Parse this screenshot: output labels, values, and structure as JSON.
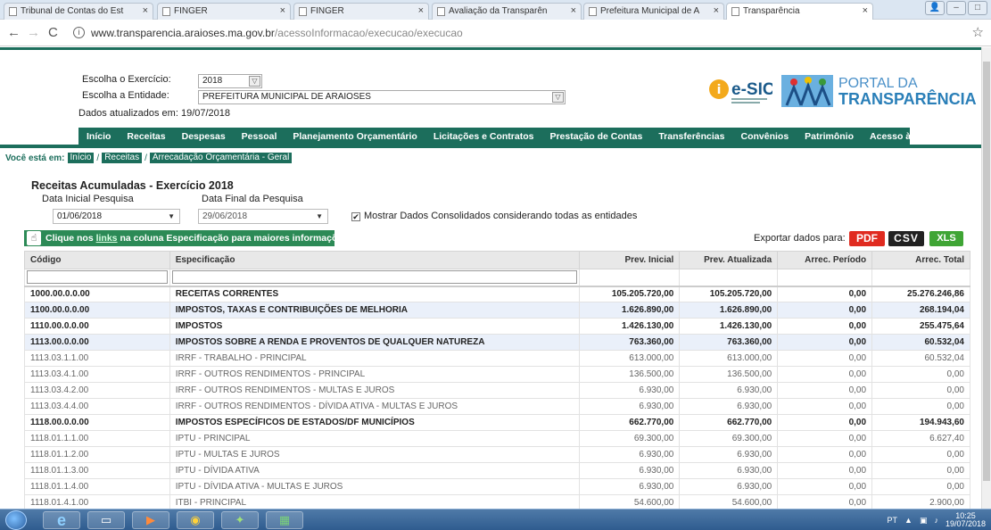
{
  "browser": {
    "tabs": [
      {
        "title": "Tribunal de Contas do Est",
        "active": false
      },
      {
        "title": "FINGER",
        "active": false
      },
      {
        "title": "FINGER",
        "active": false
      },
      {
        "title": "Avaliação da Transparên",
        "active": false
      },
      {
        "title": "Prefeitura Municipal de A",
        "active": false
      },
      {
        "title": "Transparência",
        "active": true
      }
    ],
    "url_host": "www.transparencia.araioses.ma.gov.br",
    "url_path": "/acessoInformacao/execucao/execucao"
  },
  "filters": {
    "exercicio_label": "Escolha o Exercício:",
    "exercicio_value": "2018",
    "entidade_label": "Escolha a Entidade:",
    "entidade_value": "PREFEITURA MUNICIPAL DE ARAIOSES",
    "updated": "Dados atualizados em: 19/07/2018"
  },
  "logos": {
    "esic": "e-SIC",
    "portal_line1": "PORTAL DA",
    "portal_line2": "TRANSPARÊNCIA"
  },
  "nav": [
    "Início",
    "Receitas",
    "Despesas",
    "Pessoal",
    "Planejamento Orçamentário",
    "Licitações e Contratos",
    "Prestação de Contas",
    "Transferências",
    "Convênios",
    "Patrimônio",
    "Acesso à Informação"
  ],
  "breadcrumb": {
    "prefix": "Você está em:",
    "items": [
      "Início",
      "Receitas",
      "Arrecadação Orçamentária - Geral"
    ]
  },
  "report": {
    "title": "Receitas Acumuladas - Exercício 2018",
    "date_start_label": "Data Inicial Pesquisa",
    "date_start_value": "01/06/2018",
    "date_end_label": "Data Final da Pesquisa",
    "date_end_value": "29/06/2018",
    "consolidated_label": "Mostrar Dados Consolidados considerando todas as entidades",
    "info_prefix": "Clique nos",
    "info_link": "links",
    "info_suffix": "na coluna Especificação para maiores informações.",
    "export_label": "Exportar dados para:",
    "export_pdf": "PDF",
    "export_csv": "CSV",
    "export_xls": "XLS"
  },
  "table": {
    "headers": [
      "Código",
      "Especificação",
      "Prev. Inicial",
      "Prev. Atualizada",
      "Arrec. Período",
      "Arrec. Total"
    ],
    "rows": [
      {
        "cells": [
          "1000.00.0.0.00",
          "RECEITAS CORRENTES",
          "105.205.720,00",
          "105.205.720,00",
          "0,00",
          "25.276.246,86"
        ],
        "bold": true,
        "alt": false
      },
      {
        "cells": [
          "1100.00.0.0.00",
          "IMPOSTOS, TAXAS E CONTRIBUIÇÕES DE MELHORIA",
          "1.626.890,00",
          "1.626.890,00",
          "0,00",
          "268.194,04"
        ],
        "bold": true,
        "alt": true
      },
      {
        "cells": [
          "1110.00.0.0.00",
          "IMPOSTOS",
          "1.426.130,00",
          "1.426.130,00",
          "0,00",
          "255.475,64"
        ],
        "bold": true,
        "alt": false
      },
      {
        "cells": [
          "1113.00.0.0.00",
          "IMPOSTOS SOBRE A RENDA E PROVENTOS DE QUALQUER NATUREZA",
          "763.360,00",
          "763.360,00",
          "0,00",
          "60.532,04"
        ],
        "bold": true,
        "alt": true
      },
      {
        "cells": [
          "1113.03.1.1.00",
          "IRRF - TRABALHO - PRINCIPAL",
          "613.000,00",
          "613.000,00",
          "0,00",
          "60.532,04"
        ],
        "bold": false,
        "alt": false
      },
      {
        "cells": [
          "1113.03.4.1.00",
          "IRRF - OUTROS RENDIMENTOS - PRINCIPAL",
          "136.500,00",
          "136.500,00",
          "0,00",
          "0,00"
        ],
        "bold": false,
        "alt": false
      },
      {
        "cells": [
          "1113.03.4.2.00",
          "IRRF - OUTROS RENDIMENTOS - MULTAS E JUROS",
          "6.930,00",
          "6.930,00",
          "0,00",
          "0,00"
        ],
        "bold": false,
        "alt": false
      },
      {
        "cells": [
          "1113.03.4.4.00",
          "IRRF - OUTROS RENDIMENTOS - DÍVIDA ATIVA - MULTAS E JUROS",
          "6.930,00",
          "6.930,00",
          "0,00",
          "0,00"
        ],
        "bold": false,
        "alt": false
      },
      {
        "cells": [
          "1118.00.0.0.00",
          "IMPOSTOS ESPECÍFICOS DE ESTADOS/DF MUNICÍPIOS",
          "662.770,00",
          "662.770,00",
          "0,00",
          "194.943,60"
        ],
        "bold": true,
        "alt": false
      },
      {
        "cells": [
          "1118.01.1.1.00",
          "IPTU - PRINCIPAL",
          "69.300,00",
          "69.300,00",
          "0,00",
          "6.627,40"
        ],
        "bold": false,
        "alt": false
      },
      {
        "cells": [
          "1118.01.1.2.00",
          "IPTU - MULTAS E JUROS",
          "6.930,00",
          "6.930,00",
          "0,00",
          "0,00"
        ],
        "bold": false,
        "alt": false
      },
      {
        "cells": [
          "1118.01.1.3.00",
          "IPTU - DÍVIDA ATIVA",
          "6.930,00",
          "6.930,00",
          "0,00",
          "0,00"
        ],
        "bold": false,
        "alt": false
      },
      {
        "cells": [
          "1118.01.1.4.00",
          "IPTU - DÍVIDA ATIVA - MULTAS E JUROS",
          "6.930,00",
          "6.930,00",
          "0,00",
          "0,00"
        ],
        "bold": false,
        "alt": false
      },
      {
        "cells": [
          "1118.01.4.1.00",
          "ITBI - PRINCIPAL",
          "54.600,00",
          "54.600,00",
          "0,00",
          "2.900,00"
        ],
        "bold": false,
        "alt": false
      }
    ]
  },
  "taskbar": {
    "lang": "PT",
    "time": "10:25",
    "date": "19/07/2018"
  },
  "colors": {
    "brand_green": "#1c6e5c",
    "banner_green": "#2c8a56",
    "pdf_red": "#e02b20",
    "xls_green": "#3fa535",
    "alt_row": "#eaf0fa"
  }
}
